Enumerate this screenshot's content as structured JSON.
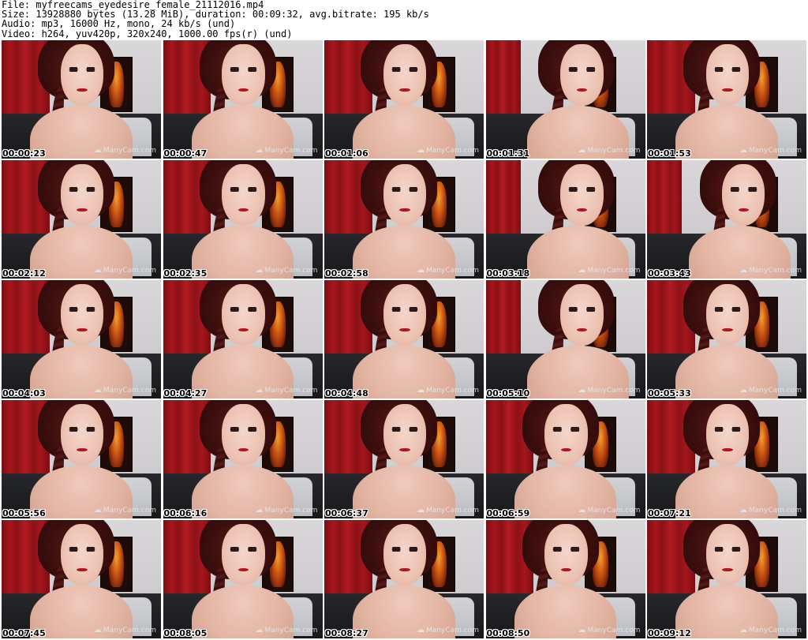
{
  "header": {
    "file": "File: myfreecams_eyedesire_female_21112016.mp4",
    "size": "Size: 13928880 bytes (13.28 MiB), duration: 00:09:32, avg.bitrate: 195 kb/s",
    "audio": "Audio: mp3, 16000 Hz, mono, 24 kb/s (und)",
    "video": "Video: h264, yuv420p, 320x240, 1000.00 fps(r) (und)"
  },
  "watermark": "ManyCam.com",
  "frames": [
    "00:00:23",
    "00:00:47",
    "00:01:06",
    "00:01:31",
    "00:01:53",
    "00:02:12",
    "00:02:35",
    "00:02:58",
    "00:03:18",
    "00:03:43",
    "00:04:03",
    "00:04:27",
    "00:04:48",
    "00:05:10",
    "00:05:33",
    "00:05:56",
    "00:06:16",
    "00:06:37",
    "00:06:59",
    "00:07:21",
    "00:07:45",
    "00:08:05",
    "00:08:27",
    "00:08:50",
    "00:09:12"
  ]
}
